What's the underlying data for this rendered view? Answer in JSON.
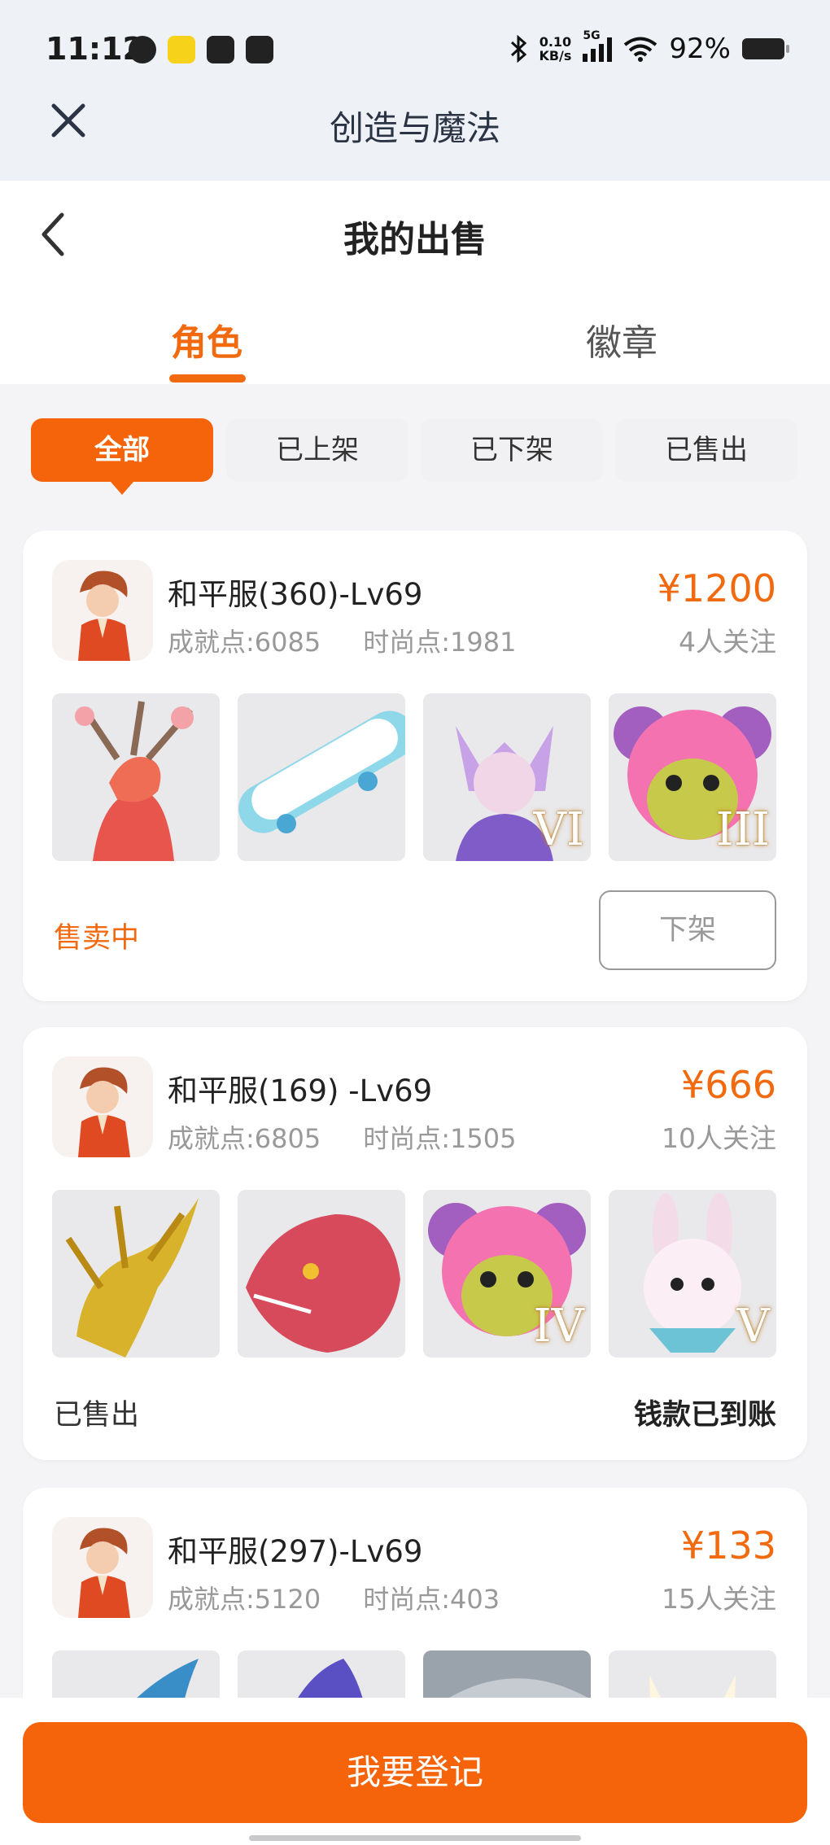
{
  "status_bar": {
    "time": "11:12",
    "net_speed_value": "0.10",
    "net_speed_unit": "KB/s",
    "network": "5G",
    "battery": "92%"
  },
  "nav": {
    "title": "创造与魔法"
  },
  "page": {
    "title": "我的出售"
  },
  "tabs": [
    {
      "label": "角色",
      "active": true
    },
    {
      "label": "徽章",
      "active": false
    }
  ],
  "filters": [
    {
      "label": "全部",
      "active": true
    },
    {
      "label": "已上架"
    },
    {
      "label": "已下架"
    },
    {
      "label": "已售出"
    }
  ],
  "listings": [
    {
      "name": "和平服(360)-Lv69",
      "achievement": "成就点:6085",
      "fashion": "时尚点:1981",
      "price": "¥1200",
      "followers": "4人关注",
      "items": [
        {
          "icon": "red-deer-dragon-mount"
        },
        {
          "icon": "skateboard"
        },
        {
          "icon": "fox-spirit-costume",
          "badge": "VI"
        },
        {
          "icon": "pink-bear-mask",
          "badge": "III"
        }
      ],
      "status": "售卖中",
      "action_label": "下架"
    },
    {
      "name": "和平服(169) -Lv69",
      "achievement": "成就点:6805",
      "fashion": "时尚点:1505",
      "price": "¥666",
      "followers": "10人关注",
      "items": [
        {
          "icon": "golden-dragon-mount"
        },
        {
          "icon": "red-dragon-head"
        },
        {
          "icon": "pink-bear-mask",
          "badge": "IV"
        },
        {
          "icon": "white-rabbit-pet",
          "badge": "V"
        }
      ],
      "status": "已售出",
      "payment_note": "钱款已到账"
    },
    {
      "name": "和平服(297)-Lv69",
      "achievement": "成就点:5120",
      "fashion": "时尚点:403",
      "price": "¥133",
      "followers": "15人关注",
      "items": [
        {
          "icon": "blue-dragon-mount"
        },
        {
          "icon": "purple-dragon-mount"
        },
        {
          "icon": "gray-creature"
        },
        {
          "icon": "white-fox-pet"
        }
      ]
    }
  ],
  "bottom_action": {
    "label": "我要登记"
  },
  "colors": {
    "accent": "#f5640a",
    "price": "#f26a10"
  }
}
